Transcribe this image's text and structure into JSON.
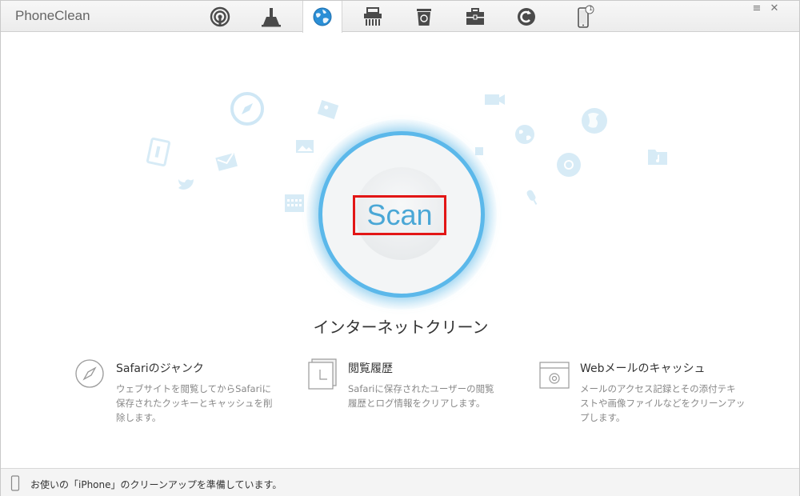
{
  "app": {
    "title": "PhoneClean"
  },
  "tabs": [
    {
      "name": "quick-clean",
      "icon": "wifi-sync-icon"
    },
    {
      "name": "deep-clean",
      "icon": "broom-icon"
    },
    {
      "name": "internet-clean",
      "icon": "globe-icon",
      "active": true
    },
    {
      "name": "privacy-clean",
      "icon": "shredder-icon"
    },
    {
      "name": "system-clean",
      "icon": "trash-can-icon"
    },
    {
      "name": "toolbox",
      "icon": "toolbox-icon"
    },
    {
      "name": "history",
      "icon": "history-icon"
    }
  ],
  "device": {
    "icon": "iphone-icon",
    "badge": "1"
  },
  "window_controls": {
    "menu": "≡",
    "close": "✕"
  },
  "scan": {
    "label": "Scan"
  },
  "section": {
    "title": "インターネットクリーン"
  },
  "features": [
    {
      "icon": "safari-compass-icon",
      "title": "Safariのジャンク",
      "desc": [
        "ウェブサイトを閲覧してからSafariに",
        "保存されたクッキーとキャッシュを削",
        "除します。"
      ]
    },
    {
      "icon": "history-pages-icon",
      "title": "閲覧履歴",
      "desc": [
        "Safariに保存されたユーザーの閲覧",
        "履歴とログ情報をクリアします。"
      ]
    },
    {
      "icon": "webmail-icon",
      "title": "Webメールのキャッシュ",
      "desc": [
        "メールのアクセス記録とその添付テキ",
        "ストや画像ファイルなどをクリーンアッ",
        "プします。"
      ]
    }
  ],
  "status": {
    "text": "お使いの「iPhone」のクリーンアップを準備しています。",
    "icon": "phone-outline-icon"
  },
  "colors": {
    "accent": "#5bb8ea",
    "highlight_border": "#e21616",
    "scan_text": "#4aa7d6"
  }
}
